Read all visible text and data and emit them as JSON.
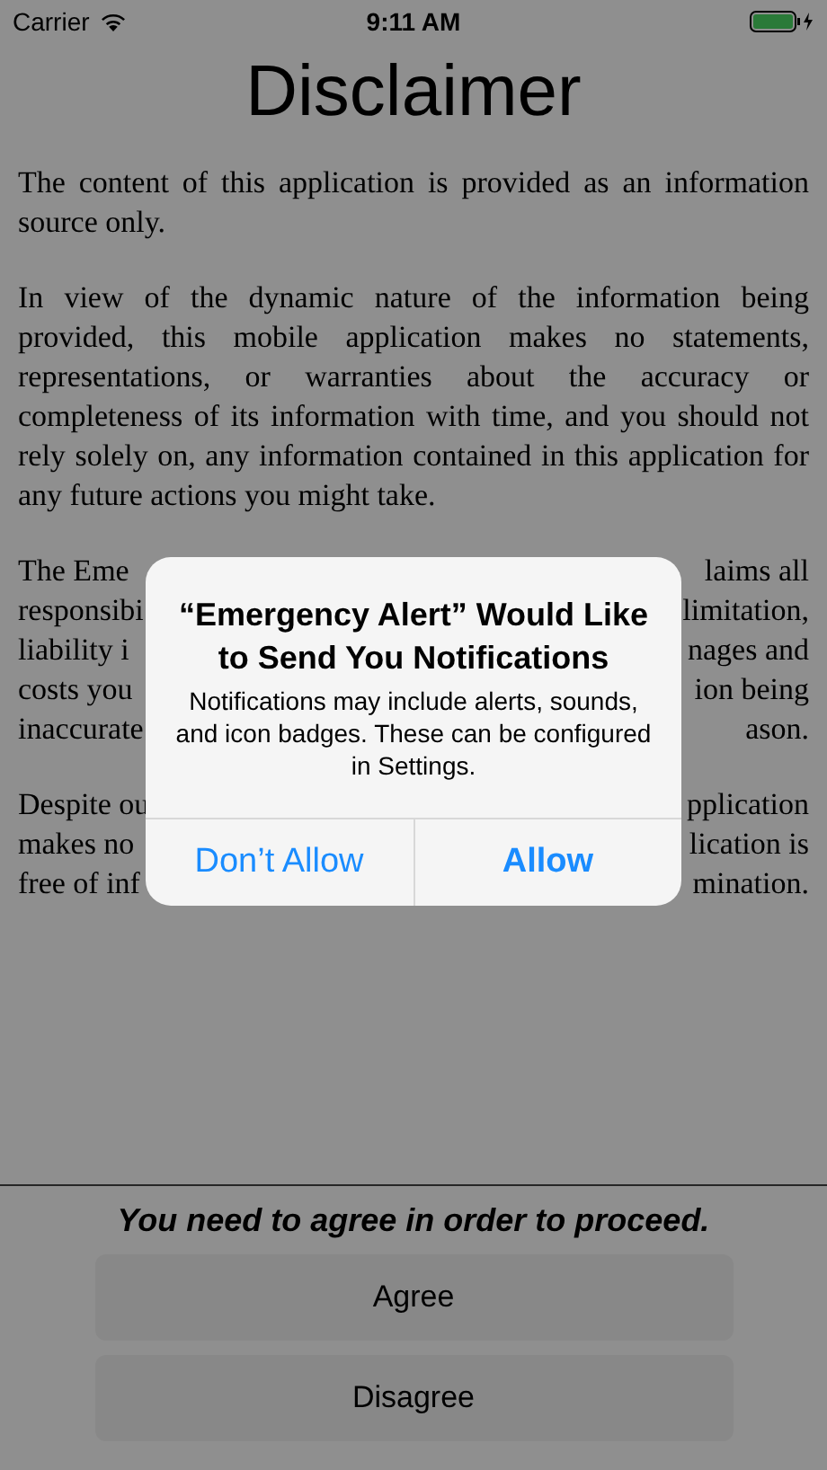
{
  "status_bar": {
    "carrier": "Carrier",
    "time": "9:11 AM"
  },
  "title": "Disclaimer",
  "paragraphs": [
    {
      "kind": "text",
      "text": "The content of this application is provided as an information source only."
    },
    {
      "kind": "text",
      "text": "In view of the dynamic nature of the information being provided, this mobile application makes no statements, representations, or warranties about the accuracy or completeness of its information with time, and you should not rely solely on, any information contained in this application for any future actions you might take."
    },
    {
      "kind": "covered",
      "lines": [
        {
          "left": "The Eme",
          "right": "laims all"
        },
        {
          "left": "responsibi",
          "right": "limitation,"
        },
        {
          "left": "liability i",
          "right": "nages and"
        },
        {
          "left": "costs you",
          "right": "ion being"
        },
        {
          "left": "inaccurate",
          "right": "ason."
        }
      ]
    },
    {
      "kind": "covered",
      "lines": [
        {
          "left": "Despite ou",
          "right": "pplication"
        },
        {
          "left": "makes no",
          "right": "lication is"
        },
        {
          "left": "free of inf",
          "right": "mination."
        }
      ]
    }
  ],
  "alert": {
    "title": "“Emergency Alert” Would Like to Send You Notifications",
    "message": "Notifications may include alerts, sounds, and icon badges. These can be configured in Settings.",
    "buttons": [
      {
        "label": "Don’t Allow",
        "kind": "cancel"
      },
      {
        "label": "Allow",
        "kind": "preferred"
      }
    ]
  },
  "footer": {
    "notice": "You need to agree in order to proceed.",
    "buttons": [
      "Agree",
      "Disagree"
    ]
  }
}
